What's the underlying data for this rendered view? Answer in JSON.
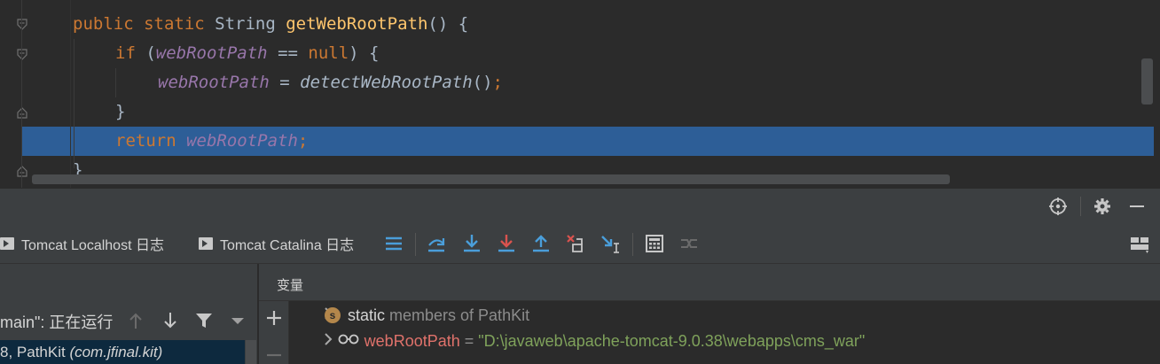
{
  "editor": {
    "lines": [
      {
        "tokens": [
          {
            "t": "public static ",
            "c": "kw"
          },
          {
            "t": "String ",
            "c": "plain"
          },
          {
            "t": "getWebRootPath",
            "c": "fn"
          },
          {
            "t": "() {",
            "c": "plain"
          }
        ]
      },
      {
        "tokens": [
          {
            "t": "if ",
            "c": "kw"
          },
          {
            "t": "(",
            "c": "plain"
          },
          {
            "t": "webRootPath",
            "c": "fld"
          },
          {
            "t": " == ",
            "c": "plain"
          },
          {
            "t": "null",
            "c": "kw"
          },
          {
            "t": ") {",
            "c": "plain"
          }
        ]
      },
      {
        "tokens": [
          {
            "t": "webRootPath",
            "c": "fld"
          },
          {
            "t": " = ",
            "c": "plain"
          },
          {
            "t": "detectWebRootPath",
            "c": "call"
          },
          {
            "t": "()",
            "c": "plain"
          },
          {
            "t": ";",
            "c": "semi"
          }
        ]
      },
      {
        "tokens": [
          {
            "t": "}",
            "c": "plain"
          }
        ]
      },
      {
        "tokens": [
          {
            "t": "return ",
            "c": "kw"
          },
          {
            "t": "webRootPath",
            "c": "fld"
          },
          {
            "t": ";",
            "c": "semi"
          }
        ]
      },
      {
        "tokens": [
          {
            "t": "}",
            "c": "plain"
          }
        ]
      }
    ]
  },
  "panel_header": {
    "icons": [
      "crosshair-icon",
      "gear-icon",
      "minimize-icon"
    ]
  },
  "tabs": [
    {
      "label": "Tomcat Localhost 日志"
    },
    {
      "label": "Tomcat Catalina 日志"
    }
  ],
  "toolbar": {
    "icons": [
      "show-execution-point-icon",
      "step-over-icon",
      "step-into-icon",
      "force-step-into-icon",
      "step-out-icon",
      "drop-frame-icon",
      "run-to-cursor-icon",
      "evaluate-expression-icon",
      "trace-icon",
      "layout-icon"
    ]
  },
  "frames": {
    "thread": "main\": 正在运行",
    "selected_frame_number": "8, PathKit ",
    "selected_frame_class": "(com.jfinal.kit)"
  },
  "variables": {
    "title": "变量",
    "rows": [
      {
        "badge": "s",
        "name": "static",
        "rest": " members of PathKit"
      },
      {
        "name": "webRootPath",
        "eq": " = ",
        "value": "\"D:\\javaweb\\apache-tomcat-9.0.38\\webapps\\cms_war\""
      }
    ]
  },
  "colors": {
    "keyword": "#cc7832",
    "method": "#ffc66d",
    "field": "#9876aa",
    "current_line": "#2d5e97",
    "string_value": "#7fa25b",
    "var_name": "#e0726b"
  }
}
